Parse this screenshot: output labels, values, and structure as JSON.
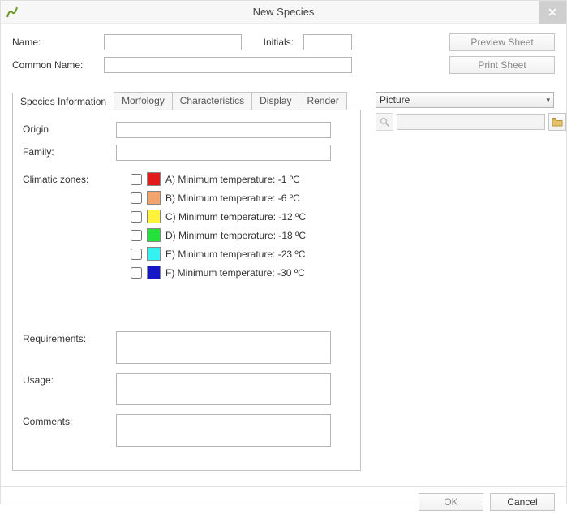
{
  "window": {
    "title": "New Species"
  },
  "header": {
    "name_label": "Name:",
    "initials_label": "Initials:",
    "common_label": "Common Name:",
    "name_value": "",
    "initials_value": "",
    "common_value": "",
    "preview_btn": "Preview Sheet",
    "print_btn": "Print Sheet"
  },
  "tabs": {
    "t0": "Species Information",
    "t1": "Morfology",
    "t2": "Characteristics",
    "t3": "Display",
    "t4": "Render"
  },
  "species": {
    "origin_label": "Origin",
    "family_label": "Family:",
    "origin_value": "",
    "family_value": "",
    "zones_label": "Climatic zones:",
    "requirements_label": "Requirements:",
    "usage_label": "Usage:",
    "comments_label": "Comments:",
    "requirements_value": "",
    "usage_value": "",
    "comments_value": ""
  },
  "zones": [
    {
      "color": "#e11b1b",
      "text": "A) Minimum temperature: -1 ºC"
    },
    {
      "color": "#f2a46e",
      "text": "B) Minimum temperature: -6 ºC"
    },
    {
      "color": "#fff23a",
      "text": "C) Minimum temperature: -12 ºC"
    },
    {
      "color": "#23e03a",
      "text": "D) Minimum temperature: -18 ºC"
    },
    {
      "color": "#35f2f2",
      "text": "E) Minimum temperature: -23 ºC"
    },
    {
      "color": "#1616c8",
      "text": "F) Minimum temperature: -30 ºC"
    }
  ],
  "picture": {
    "combo_label": "Picture",
    "path_value": ""
  },
  "footer": {
    "ok": "OK",
    "cancel": "Cancel"
  }
}
